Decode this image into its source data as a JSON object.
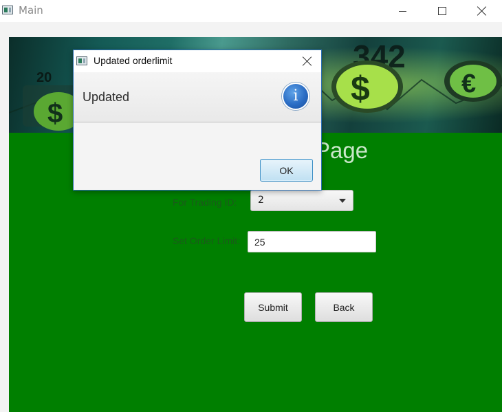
{
  "window": {
    "title": "Main",
    "icon": "java-app-icon"
  },
  "page": {
    "heading": "Page",
    "trading_label": "For Trading ID:",
    "trading_value": "2",
    "limit_label": "Set Order Limit:",
    "limit_value": "25",
    "submit_label": "Submit",
    "back_label": "Back",
    "background_color": "#007f00"
  },
  "banner": {
    "texts": [
      "342",
      "20",
      "$",
      "$",
      "€"
    ]
  },
  "dialog": {
    "title": "Updated orderlimit",
    "message": "Updated",
    "ok_label": "OK",
    "icon": "info-icon",
    "icon_glyph": "i"
  }
}
